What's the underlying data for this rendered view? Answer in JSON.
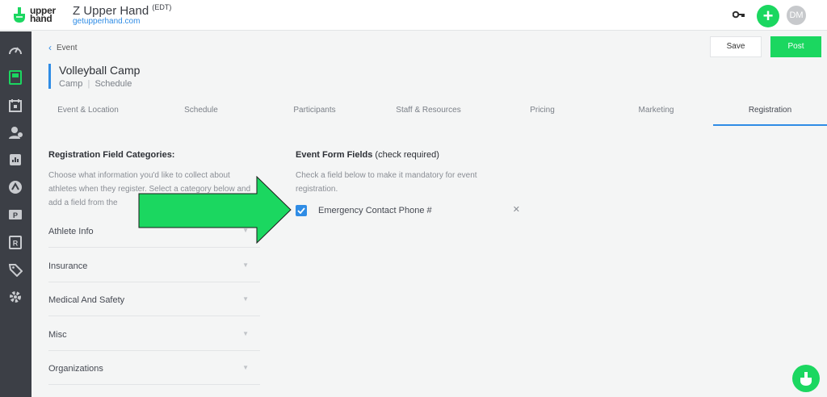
{
  "app": {
    "logo_text": "upper hand",
    "brand_name": "Z Upper Hand",
    "brand_tz": "(EDT)",
    "brand_url": "getupperhand.com",
    "avatar_initials": "DM"
  },
  "sidebar": {
    "icons": [
      "dashboard-icon",
      "events-icon",
      "calendar-icon",
      "clients-icon",
      "reports-icon",
      "marketing-icon",
      "pos-icon",
      "resources-icon",
      "tags-icon",
      "settings-icon"
    ]
  },
  "header": {
    "back_label": "Event",
    "title": "Volleyball Camp",
    "type": "Camp",
    "separator": "|",
    "sub": "Schedule",
    "save_label": "Save",
    "post_label": "Post"
  },
  "tabs": [
    {
      "label": "Event & Location"
    },
    {
      "label": "Schedule"
    },
    {
      "label": "Participants"
    },
    {
      "label": "Staff & Resources"
    },
    {
      "label": "Pricing"
    },
    {
      "label": "Marketing"
    },
    {
      "label": "Registration",
      "active": true
    }
  ],
  "left": {
    "title": "Registration Field Categories:",
    "desc": "Choose what information you'd like to collect about athletes when they register. Select a category below and add a field from the",
    "categories": [
      "Athlete Info",
      "Insurance",
      "Medical And Safety",
      "Misc",
      "Organizations"
    ]
  },
  "right": {
    "title_bold": "Event Form Fields",
    "title_rest": "(check required)",
    "desc": "Check a field below to make it mandatory for event registration.",
    "fields": [
      {
        "label": "Emergency Contact Phone #",
        "checked": true
      }
    ]
  },
  "colors": {
    "accent": "#1bd760",
    "blue": "#2f8ce5",
    "sidebar": "#3c3f46"
  }
}
